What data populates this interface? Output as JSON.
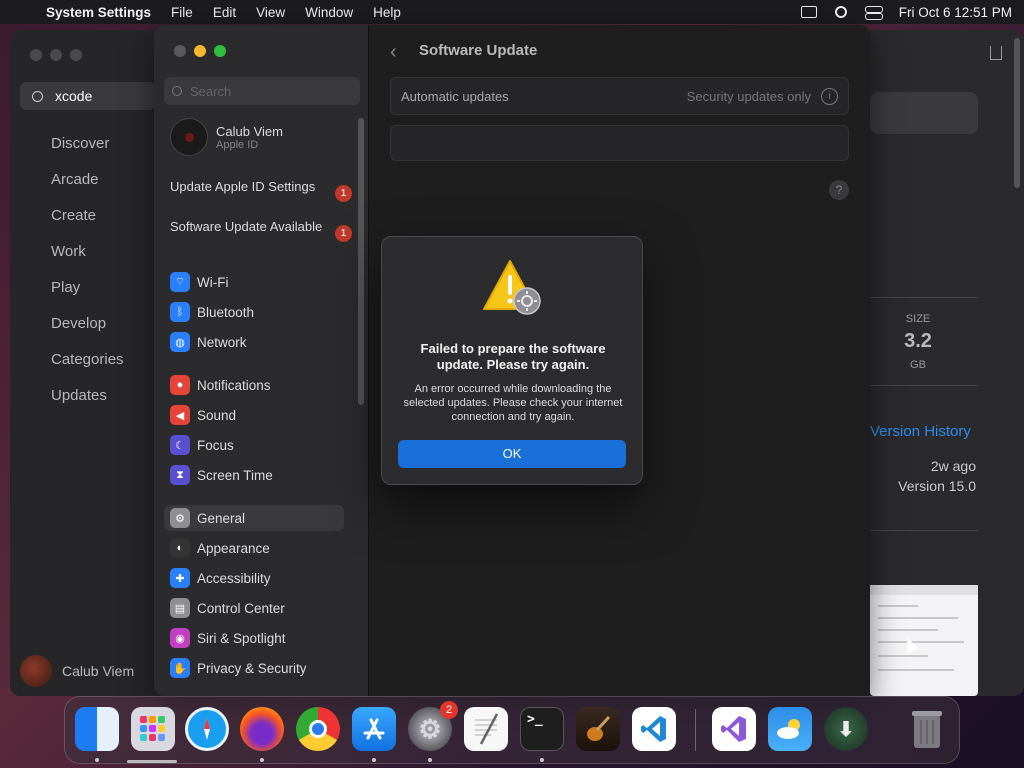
{
  "menubar": {
    "app_name": "System Settings",
    "menus": [
      "File",
      "Edit",
      "View",
      "Window",
      "Help"
    ],
    "datetime": "Fri Oct 6  12:51 PM"
  },
  "appstore": {
    "search_value": "xcode",
    "nav": [
      "Discover",
      "Arcade",
      "Create",
      "Work",
      "Play",
      "Develop",
      "Categories",
      "Updates"
    ],
    "user_name": "Calub Viem",
    "size_label": "SIZE",
    "size_value": "3.2",
    "size_unit": "GB",
    "version_history": "Version History",
    "updated_ago": "2w ago",
    "version": "Version 15.0"
  },
  "settings": {
    "search_placeholder": "Search",
    "user": {
      "name": "Calub Viem",
      "subtitle": "Apple ID"
    },
    "notices": [
      {
        "label": "Update Apple ID Settings",
        "badge": "1"
      },
      {
        "label": "Software Update Available",
        "badge": "1"
      }
    ],
    "sidebar_items": [
      {
        "label": "Wi-Fi",
        "icon": "wifi-icon",
        "color": "#2a7fff"
      },
      {
        "label": "Bluetooth",
        "icon": "bluetooth-icon",
        "color": "#2a7fff"
      },
      {
        "label": "Network",
        "icon": "globe-icon",
        "color": "#2a7fff"
      },
      {
        "label": "Notifications",
        "icon": "bell-icon",
        "color": "#e5443a"
      },
      {
        "label": "Sound",
        "icon": "speaker-icon",
        "color": "#e5443a"
      },
      {
        "label": "Focus",
        "icon": "moon-icon",
        "color": "#5a4fcf"
      },
      {
        "label": "Screen Time",
        "icon": "hourglass-icon",
        "color": "#5a4fcf"
      },
      {
        "label": "General",
        "icon": "gear-icon",
        "color": "#8e8e93"
      },
      {
        "label": "Appearance",
        "icon": "appearance-icon",
        "color": "#333333"
      },
      {
        "label": "Accessibility",
        "icon": "accessibility-icon",
        "color": "#2a7fff"
      },
      {
        "label": "Control Center",
        "icon": "control-center-icon",
        "color": "#8e8e93"
      },
      {
        "label": "Siri & Spotlight",
        "icon": "siri-icon",
        "color": "#c040c0"
      },
      {
        "label": "Privacy & Security",
        "icon": "hand-icon",
        "color": "#2a7fff"
      }
    ],
    "page_title": "Software Update",
    "automatic_updates_label": "Automatic updates",
    "automatic_updates_value": "Security updates only",
    "help_label": "?"
  },
  "dialog": {
    "title": "Failed to prepare the software update. Please try again.",
    "message": "An error occurred while downloading the selected updates. Please check your internet connection and try again.",
    "ok_label": "OK"
  },
  "dock": {
    "apps": [
      {
        "name": "finder",
        "color": "#2f8bf5"
      },
      {
        "name": "launchpad",
        "color": "#d8d8e0"
      },
      {
        "name": "safari",
        "color": "#1a9ef0"
      },
      {
        "name": "firefox",
        "color": "#ff7a1a"
      },
      {
        "name": "chrome",
        "color": "#ffffff"
      },
      {
        "name": "app-store",
        "color": "#1d8cf5"
      },
      {
        "name": "system-settings",
        "color": "#777780",
        "badge": "2"
      },
      {
        "name": "textedit",
        "color": "#f4f4f4"
      },
      {
        "name": "terminal",
        "color": "#1e1e1e",
        "glyph": ">_"
      },
      {
        "name": "garageband",
        "color": "#3a2a20"
      },
      {
        "name": "vscode",
        "color": "#ffffff"
      },
      {
        "name": "visual-studio",
        "color": "#ffffff"
      },
      {
        "name": "weather",
        "color": "#3aa0f0"
      },
      {
        "name": "downloads",
        "color": "#2a4a3a"
      },
      {
        "name": "trash",
        "color": "#7a7a80"
      }
    ]
  }
}
